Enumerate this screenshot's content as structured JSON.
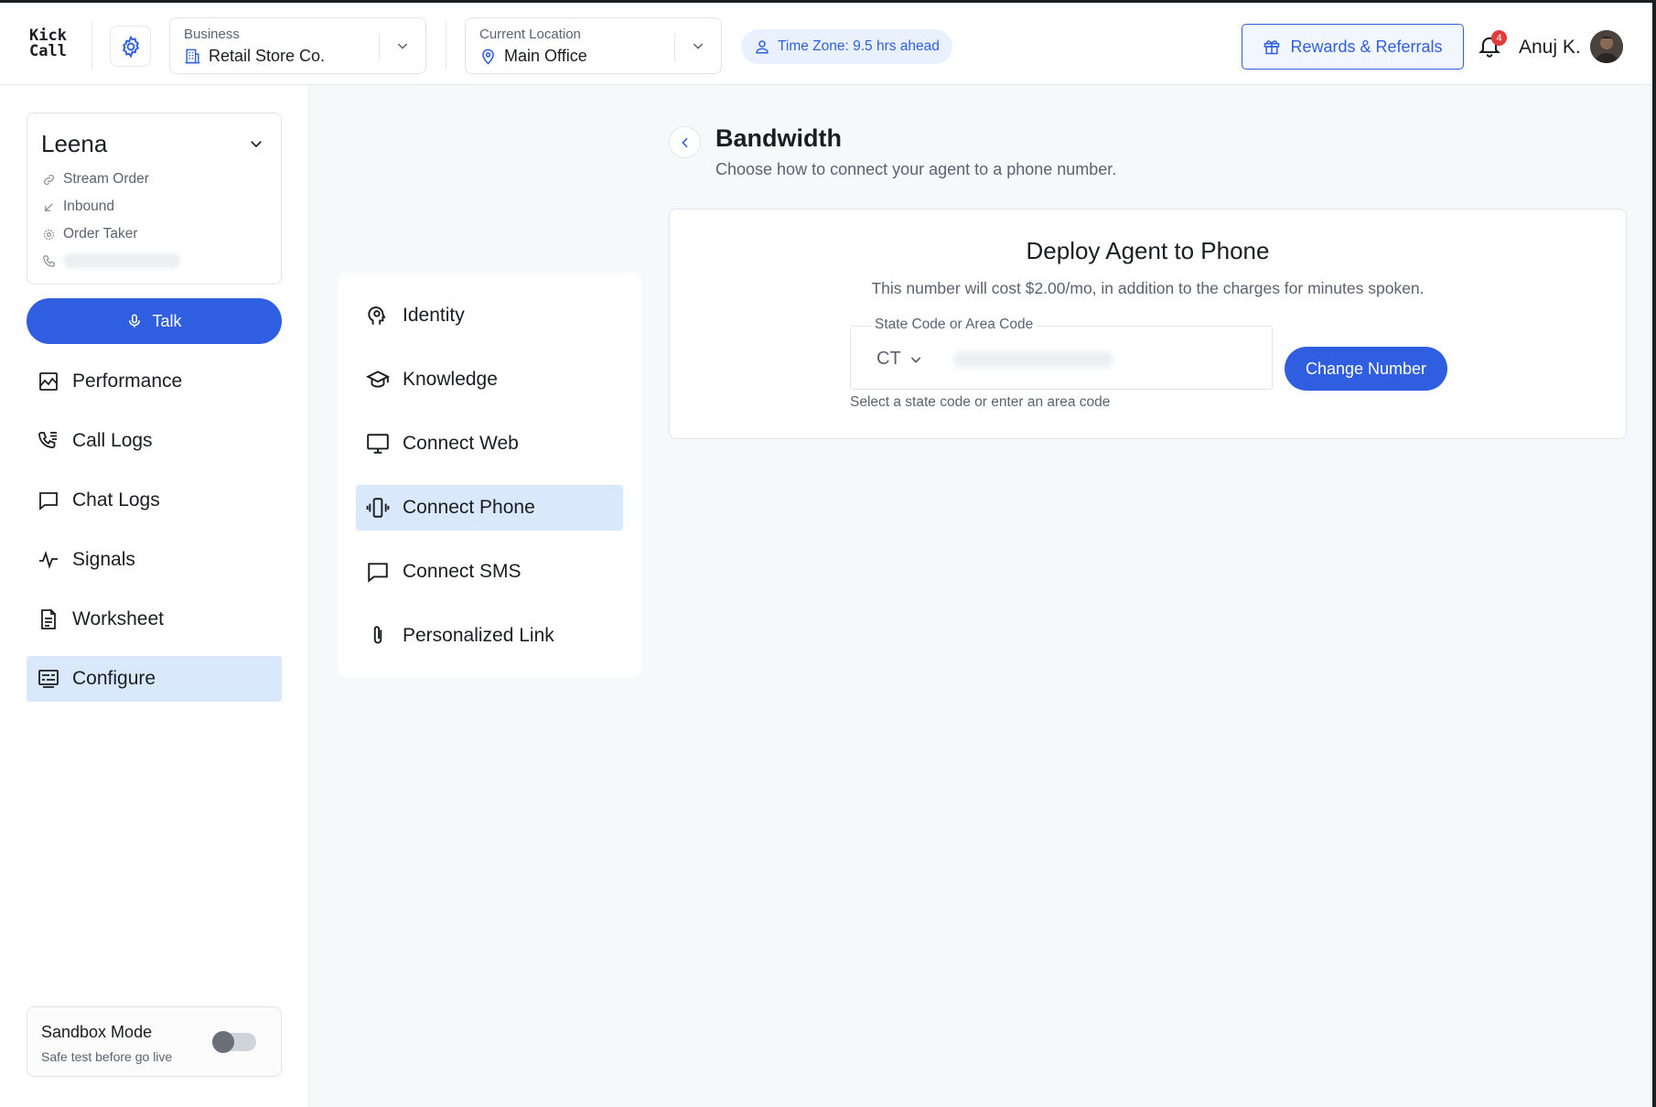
{
  "header": {
    "logo_line1": "Kick",
    "logo_line2": "Call",
    "business": {
      "caption": "Business",
      "value": "Retail Store Co."
    },
    "location": {
      "caption": "Current Location",
      "value": "Main Office"
    },
    "timezone": "Time Zone: 9.5 hrs ahead",
    "rewards_label": "Rewards & Referrals",
    "notification_count": "4",
    "user_name": "Anuj K."
  },
  "agent": {
    "name": "Leena",
    "meta": [
      {
        "icon": "link-icon",
        "label": "Stream Order"
      },
      {
        "icon": "inbound-arrow-icon",
        "label": "Inbound"
      },
      {
        "icon": "settings-icon",
        "label": "Order Taker"
      }
    ],
    "talk_label": "Talk"
  },
  "sidebar": {
    "items": [
      {
        "icon": "chart-icon",
        "label": "Performance",
        "active": false
      },
      {
        "icon": "phone-list-icon",
        "label": "Call Logs",
        "active": false
      },
      {
        "icon": "chat-icon",
        "label": "Chat Logs",
        "active": false
      },
      {
        "icon": "pulse-icon",
        "label": "Signals",
        "active": false
      },
      {
        "icon": "document-icon",
        "label": "Worksheet",
        "active": false
      },
      {
        "icon": "configure-icon",
        "label": "Configure",
        "active": true
      }
    ],
    "sandbox": {
      "title": "Sandbox Mode",
      "subtitle": "Safe test before go live",
      "enabled": false
    }
  },
  "config_menu": {
    "items": [
      {
        "icon": "identity-icon",
        "label": "Identity",
        "active": false
      },
      {
        "icon": "graduation-cap-icon",
        "label": "Knowledge",
        "active": false
      },
      {
        "icon": "monitor-icon",
        "label": "Connect Web",
        "active": false
      },
      {
        "icon": "vibrating-phone-icon",
        "label": "Connect Phone",
        "active": true
      },
      {
        "icon": "message-icon",
        "label": "Connect SMS",
        "active": false
      },
      {
        "icon": "paperclip-icon",
        "label": "Personalized Link",
        "active": false
      }
    ]
  },
  "main": {
    "title": "Bandwidth",
    "subtitle": "Choose how to connect your agent to a phone number.",
    "deploy": {
      "title": "Deploy Agent to Phone",
      "description": "This number will cost $2.00/mo, in addition to the charges for minutes spoken.",
      "field_label": "State Code or Area Code",
      "state_code": "CT",
      "helper": "Select a state code or enter an area code",
      "button_label": "Change Number"
    }
  },
  "colors": {
    "accent": "#2f5fe0",
    "active_bg": "#d9e9fb",
    "badge": "#e23b3b"
  }
}
